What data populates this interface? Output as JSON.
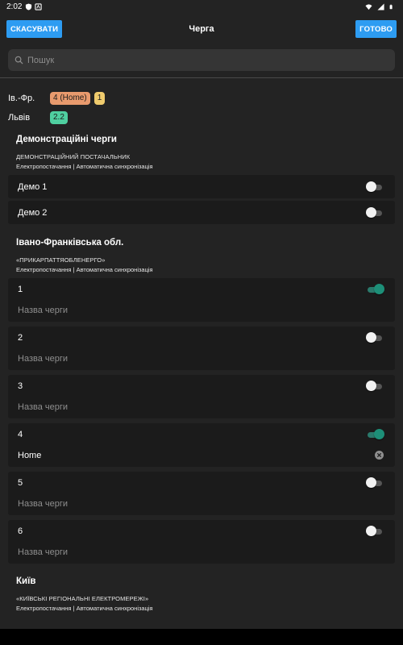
{
  "status": {
    "time": "2:02"
  },
  "header": {
    "cancel_label": "СКАСУВАТИ",
    "title": "Черга",
    "done_label": "ГОТОВО"
  },
  "search": {
    "placeholder": "Пошук"
  },
  "summary": [
    {
      "label": "Ів.-Фр.",
      "chips": [
        {
          "text": "4 (Home)",
          "color": "#e89a6d"
        },
        {
          "text": "1",
          "color": "#efcb6d"
        }
      ]
    },
    {
      "label": "Львів",
      "chips": [
        {
          "text": "2.2",
          "color": "#4fcfa0"
        }
      ]
    }
  ],
  "demo_section": {
    "title": "Демонстраційні черги",
    "provider": "ДЕМОНСТРАЦІЙНИЙ ПОСТАЧАЛЬНИК",
    "provider_sub": "Електропостачання | Автоматична синхронізація",
    "items": [
      {
        "label": "Демо 1",
        "enabled": false
      },
      {
        "label": "Демо 2",
        "enabled": false
      }
    ]
  },
  "if_section": {
    "title": "Івано-Франківська обл.",
    "provider": "«ПРИКАРПАТТЯОБЛЕНЕРГО»",
    "provider_sub": "Електропостачання | Автоматична синхронізація",
    "queues": [
      {
        "number": "1",
        "enabled": true,
        "name": "",
        "placeholder": "Назва черги"
      },
      {
        "number": "2",
        "enabled": false,
        "name": "",
        "placeholder": "Назва черги"
      },
      {
        "number": "3",
        "enabled": false,
        "name": "",
        "placeholder": "Назва черги"
      },
      {
        "number": "4",
        "enabled": true,
        "name": "Home",
        "placeholder": "Назва черги"
      },
      {
        "number": "5",
        "enabled": false,
        "name": "",
        "placeholder": "Назва черги"
      },
      {
        "number": "6",
        "enabled": false,
        "name": "",
        "placeholder": "Назва черги"
      }
    ]
  },
  "kyiv_section": {
    "title": "Київ",
    "provider": "«КИЇВСЬКІ РЕГІОНАЛЬНІ ЕЛЕКТРОМЕРЕЖІ»",
    "provider_sub": "Електропостачання | Автоматична синхронізація"
  }
}
